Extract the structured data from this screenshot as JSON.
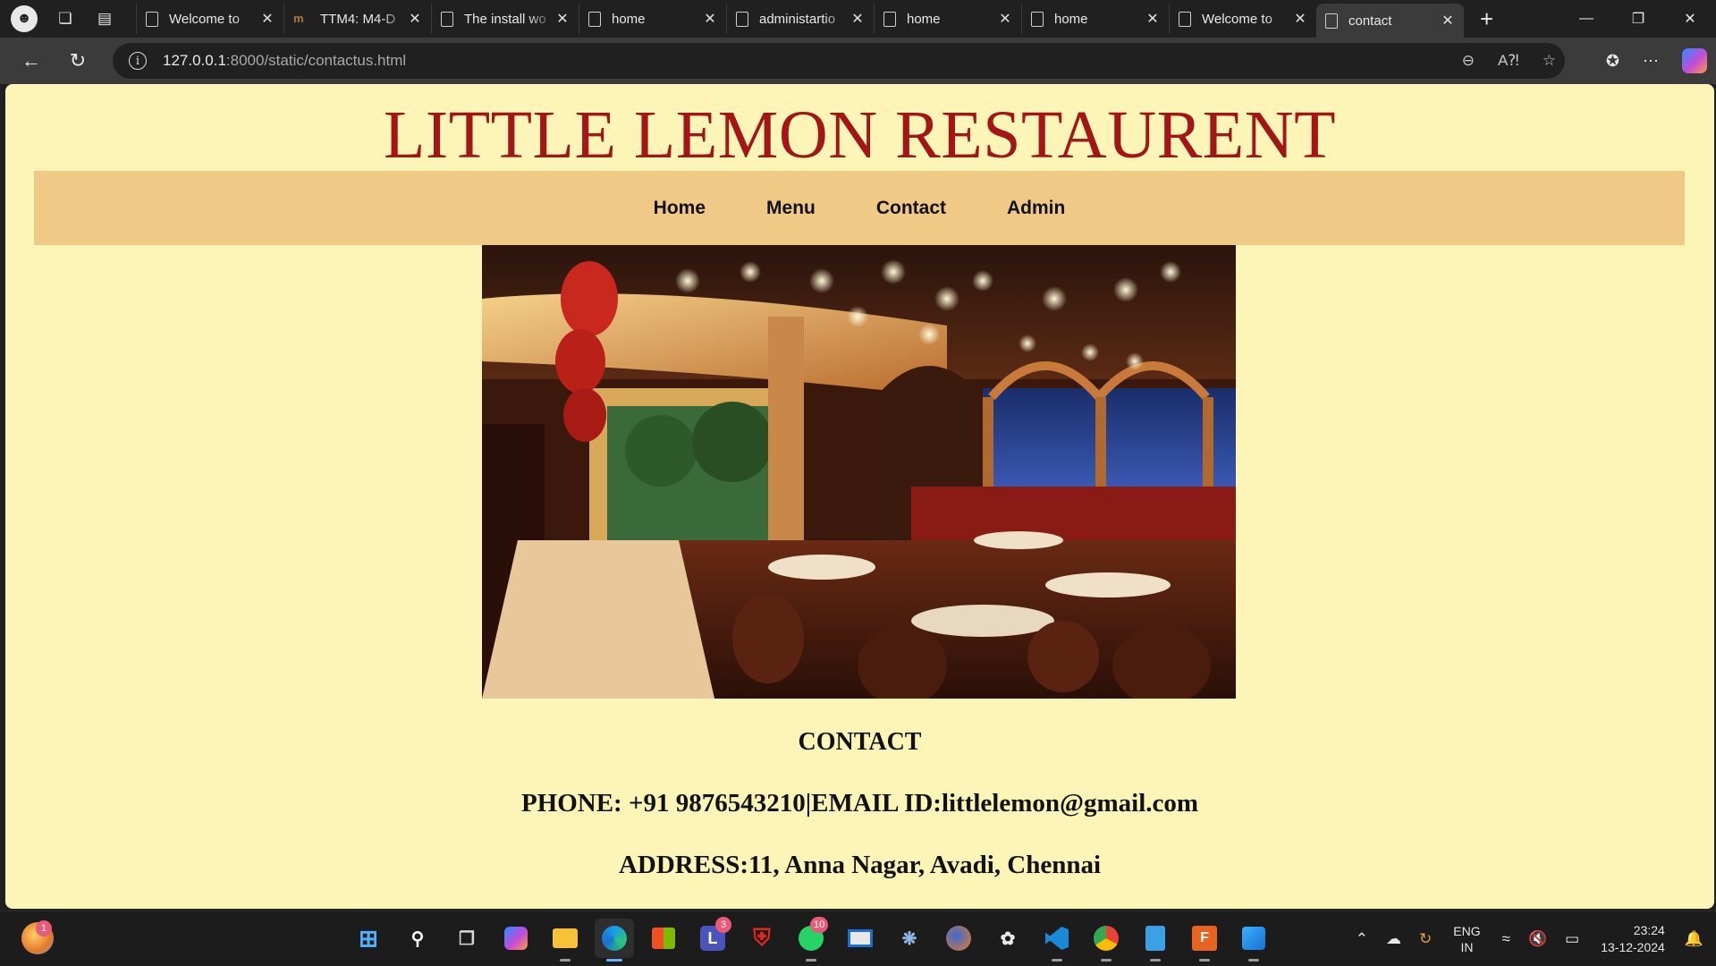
{
  "browser": {
    "tabs": [
      {
        "title": "Welcome to  ",
        "icon": "page-icon",
        "active": false
      },
      {
        "title": "TTM4: M4-D",
        "icon": "m-logo-icon",
        "active": false
      },
      {
        "title": "The install wo",
        "icon": "page-icon",
        "active": false
      },
      {
        "title": "home",
        "icon": "page-icon",
        "active": false
      },
      {
        "title": "administartio",
        "icon": "page-icon",
        "active": false
      },
      {
        "title": "home",
        "icon": "page-icon",
        "active": false
      },
      {
        "title": "home",
        "icon": "page-icon",
        "active": false
      },
      {
        "title": "Welcome to  ",
        "icon": "page-icon",
        "active": false
      },
      {
        "title": "contact",
        "icon": "page-icon",
        "active": true
      }
    ],
    "url_host": "127.0.0.1",
    "url_rest": ":8000/static/contactus.html"
  },
  "page": {
    "title": "LITTLE LEMON RESTAURENT",
    "nav": [
      "Home",
      "Menu",
      "Contact",
      "Admin"
    ],
    "contact_heading": "CONTACT",
    "phone_line": "PHONE: +91 9876543210|EMAIL ID:littlelemon@gmail.com",
    "address_line": "ADDRESS:11, Anna Nagar, Avadi, Chennai",
    "colors": {
      "background": "#fdf4b8",
      "title": "#a31616",
      "nav_bar": "#f1c987"
    }
  },
  "taskbar": {
    "weather_badge": "1",
    "teams_badge": "3",
    "whatsapp_badge": "10",
    "lang_top": "ENG",
    "lang_bottom": "IN",
    "time": "23:24",
    "date": "13-12-2024"
  }
}
